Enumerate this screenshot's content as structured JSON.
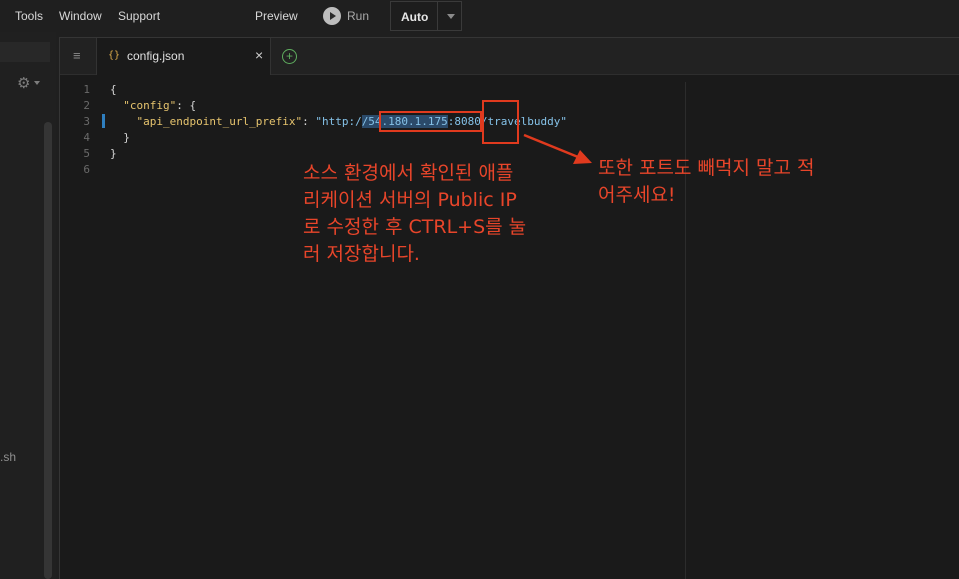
{
  "menubar": {
    "items": [
      "Tools",
      "Window",
      "Support",
      "Preview"
    ],
    "run_label": "Run",
    "runner_select": "Auto"
  },
  "sidebar": {
    "file_fragment": ".sh"
  },
  "editor": {
    "tab": {
      "icon": "{}",
      "label": "config.json",
      "close": "×"
    },
    "add_tab": "+",
    "line_numbers": [
      "1",
      "2",
      "3",
      "4",
      "5",
      "6"
    ],
    "code": {
      "l1": "{",
      "l2_indent": "  ",
      "l2_key": "\"config\"",
      "l2_rest": ": {",
      "l3_indent": "    ",
      "l3_key": "\"api_endpoint_url_prefix\"",
      "l3_colon": ": ",
      "l3_val_a": "\"http:/",
      "l3_val_sel": "/54.180.1.175",
      "l3_val_b": ":8080/travelbuddy\"",
      "l4": "  }",
      "l5": "}"
    }
  },
  "annotations": {
    "main_note_lines": [
      "소스 환경에서 확인된 애플",
      "리케이션 서버의 Public IP",
      "로 수정한 후 CTRL+S를 눌",
      "러 저장합니다."
    ],
    "port_note_lines": [
      "또한 포트도 빼먹지 말고 적",
      "어주세요!"
    ],
    "color": "#e8452a"
  }
}
